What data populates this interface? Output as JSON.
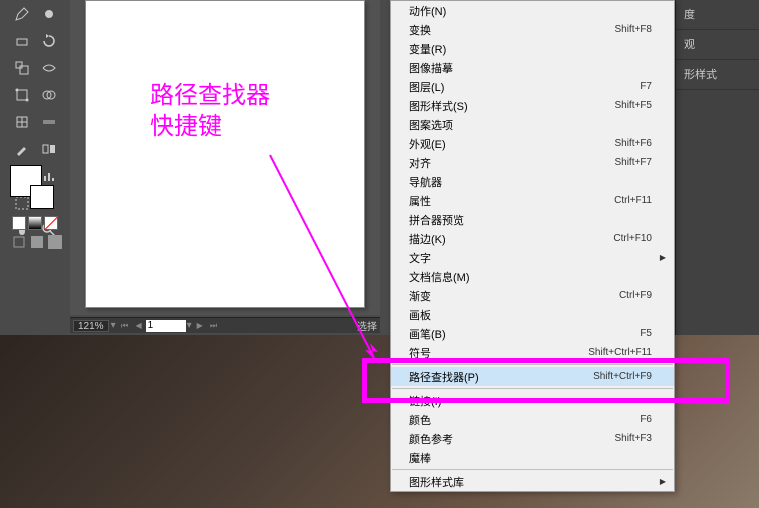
{
  "annotation": {
    "line1": "路径查找器",
    "line2": "快捷键"
  },
  "statusbar": {
    "zoom": "121%",
    "page": "1",
    "label": "选择"
  },
  "menu": {
    "items": [
      {
        "label": "动作(N)",
        "shortcut": "",
        "sep": false
      },
      {
        "label": "变换",
        "shortcut": "Shift+F8",
        "sep": false
      },
      {
        "label": "变量(R)",
        "shortcut": "",
        "sep": false
      },
      {
        "label": "图像描摹",
        "shortcut": "",
        "sep": false
      },
      {
        "label": "图层(L)",
        "shortcut": "F7",
        "sep": false
      },
      {
        "label": "图形样式(S)",
        "shortcut": "Shift+F5",
        "sep": false
      },
      {
        "label": "图案选项",
        "shortcut": "",
        "sep": false
      },
      {
        "label": "外观(E)",
        "shortcut": "Shift+F6",
        "sep": false
      },
      {
        "label": "对齐",
        "shortcut": "Shift+F7",
        "sep": false
      },
      {
        "label": "导航器",
        "shortcut": "",
        "sep": false
      },
      {
        "label": "属性",
        "shortcut": "Ctrl+F11",
        "sep": false
      },
      {
        "label": "拼合器预览",
        "shortcut": "",
        "sep": false
      },
      {
        "label": "描边(K)",
        "shortcut": "Ctrl+F10",
        "sep": false
      },
      {
        "label": "文字",
        "shortcut": "",
        "arrow": true,
        "sep": false
      },
      {
        "label": "文档信息(M)",
        "shortcut": "",
        "sep": false
      },
      {
        "label": "渐变",
        "shortcut": "Ctrl+F9",
        "sep": false
      },
      {
        "label": "画板",
        "shortcut": "",
        "sep": false
      },
      {
        "label": "画笔(B)",
        "shortcut": "F5",
        "sep": false
      },
      {
        "label": "符号",
        "shortcut": "Shift+Ctrl+F11",
        "sep": true
      },
      {
        "label": "路径查找器(P)",
        "shortcut": "Shift+Ctrl+F9",
        "highlight": true,
        "sep": true
      },
      {
        "label": "链接(I)",
        "shortcut": "",
        "sep": false
      },
      {
        "label": "颜色",
        "shortcut": "F6",
        "sep": false
      },
      {
        "label": "颜色参考",
        "shortcut": "Shift+F3",
        "sep": false
      },
      {
        "label": "魔棒",
        "shortcut": "",
        "sep": true
      },
      {
        "label": "图形样式库",
        "shortcut": "",
        "arrow": true,
        "sep": false
      }
    ]
  },
  "panels": {
    "item1": "度",
    "item2": "观",
    "item3": "形样式"
  }
}
